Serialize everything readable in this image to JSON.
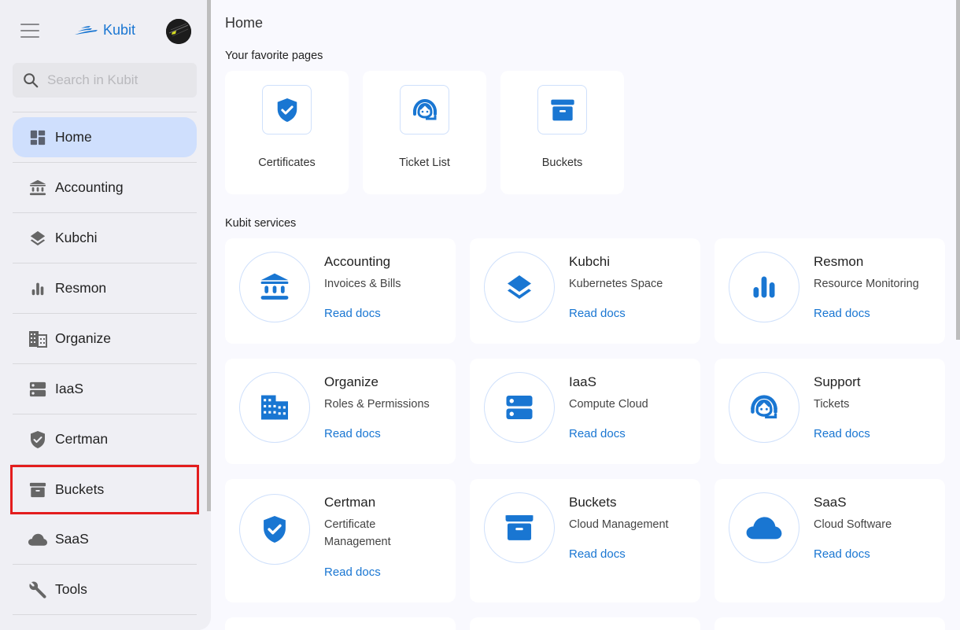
{
  "app": {
    "name": "Kubit",
    "brand_color": "#1976d2",
    "menu_icon": "hamburger-menu-icon",
    "avatar_alt": "User avatar"
  },
  "sidebar": {
    "search_placeholder": "Search in Kubit",
    "search_value": "",
    "items": [
      {
        "label": "Home",
        "icon": "dashboard-icon",
        "active": true
      },
      {
        "label": "Accounting",
        "icon": "bank-icon"
      },
      {
        "label": "Kubchi",
        "icon": "layers-icon"
      },
      {
        "label": "Resmon",
        "icon": "bar-chart-icon"
      },
      {
        "label": "Organize",
        "icon": "building-icon"
      },
      {
        "label": "IaaS",
        "icon": "server-icon"
      },
      {
        "label": "Certman",
        "icon": "shield-check-icon"
      },
      {
        "label": "Buckets",
        "icon": "archive-box-icon",
        "highlighted": true
      },
      {
        "label": "SaaS",
        "icon": "cloud-icon"
      },
      {
        "label": "Tools",
        "icon": "wrench-icon"
      }
    ]
  },
  "main": {
    "page_title": "Home",
    "favorites_title": "Your favorite pages",
    "favorites": [
      {
        "label": "Certificates",
        "icon": "shield-check-icon"
      },
      {
        "label": "Ticket List",
        "icon": "headset-icon"
      },
      {
        "label": "Buckets",
        "icon": "archive-box-icon"
      }
    ],
    "services_title": "Kubit services",
    "services": [
      {
        "name": "Accounting",
        "desc": "Invoices & Bills",
        "link": "Read docs",
        "icon": "bank-icon"
      },
      {
        "name": "Kubchi",
        "desc": "Kubernetes Space",
        "link": "Read docs",
        "icon": "layers-icon"
      },
      {
        "name": "Resmon",
        "desc": "Resource Monitoring",
        "link": "Read docs",
        "icon": "bar-chart-icon"
      },
      {
        "name": "Organize",
        "desc": "Roles & Permissions",
        "link": "Read docs",
        "icon": "building-icon"
      },
      {
        "name": "IaaS",
        "desc": "Compute Cloud",
        "link": "Read docs",
        "icon": "server-icon"
      },
      {
        "name": "Support",
        "desc": "Tickets",
        "link": "Read docs",
        "icon": "headset-icon"
      },
      {
        "name": "Certman",
        "desc": "Certificate Management",
        "link": "Read docs",
        "icon": "shield-check-icon"
      },
      {
        "name": "Buckets",
        "desc": "Cloud Management",
        "link": "Read docs",
        "icon": "archive-box-icon"
      },
      {
        "name": "SaaS",
        "desc": "Cloud Software",
        "link": "Read docs",
        "icon": "cloud-icon"
      }
    ]
  }
}
